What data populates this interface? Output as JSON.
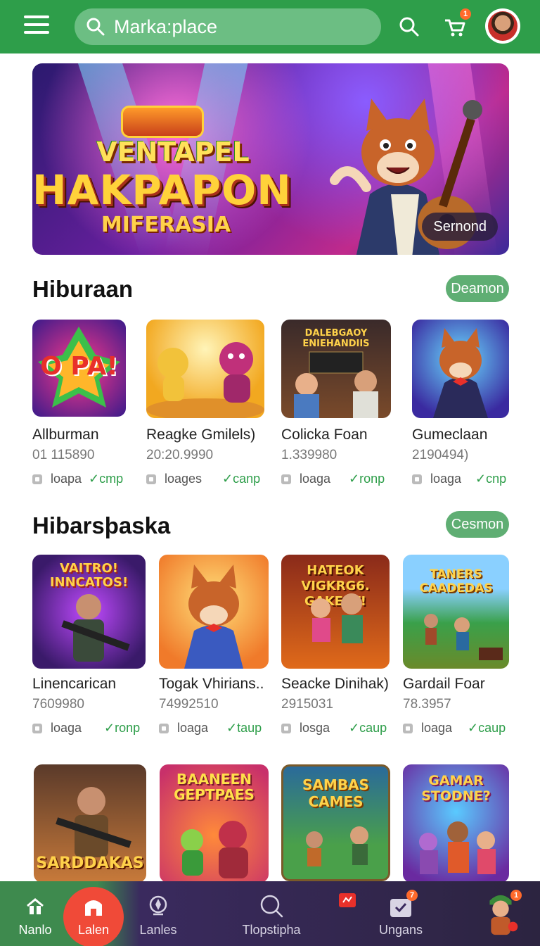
{
  "header": {
    "search_placeholder": "Marka:place",
    "notification_count": "1",
    "icons": [
      "menu-icon",
      "search-icon",
      "cart-icon",
      "avatar"
    ]
  },
  "banner": {
    "line1": "VENTAPEL",
    "line2": "HAKPAPON",
    "line3": "MIFERASIA",
    "button": "Sernond"
  },
  "section1": {
    "title": "Hiburaan",
    "button": "Deamon",
    "items": [
      {
        "title": "Allburman",
        "number": "01 115890",
        "tag": "loapa",
        "status": "✓cmp",
        "thumb_text": "O PA!"
      },
      {
        "title": "Reagke Gmilels)",
        "number": "20:20.9990",
        "tag": "loages",
        "status": "✓canp",
        "thumb_text": ""
      },
      {
        "title": "Colicka Foan",
        "number": "1.339980",
        "tag": "loaga",
        "status": "✓ronp",
        "thumb_text": "DALEBGAOY ENIEHANDIIS"
      },
      {
        "title": "Gumeclaan",
        "number": "2190494)",
        "tag": "loaga",
        "status": "✓cnp",
        "thumb_text": ""
      }
    ]
  },
  "section2": {
    "title": "Hibarsþaska",
    "button": "Cesmon",
    "items": [
      {
        "title": "Linencarican",
        "number": "7609980",
        "tag": "loaga",
        "status": "✓ronp",
        "thumb_text": "VAITRO! INNCATOS!"
      },
      {
        "title": "Togak Vhirians..",
        "number": "74992510",
        "tag": "loaga",
        "status": "✓taup",
        "thumb_text": ""
      },
      {
        "title": "Seacke Dinihak)",
        "number": "2915031",
        "tag": "losga",
        "status": "✓caup",
        "thumb_text": "HATEOK VIGKRG6. GAKEAT!"
      },
      {
        "title": "Gardail Foar",
        "number": "78.3957",
        "tag": "loaga",
        "status": "✓caup",
        "thumb_text": "TANERS CAADEDAS"
      }
    ]
  },
  "section3": {
    "items": [
      {
        "thumb_text": "SARDDAKAS"
      },
      {
        "thumb_text": "BAANEEN GEPTPAES"
      },
      {
        "thumb_text": "SAMBAS CAMES"
      },
      {
        "thumb_text": "GAMAR STODNE?"
      }
    ]
  },
  "bottom_nav": {
    "items": [
      {
        "label": "Nanlo",
        "icon": "home-icon"
      },
      {
        "label": "Lalen",
        "icon": "store-icon"
      },
      {
        "label": "Lanles",
        "icon": "compass-icon"
      },
      {
        "label": "Tlopstipha",
        "icon": "search-icon"
      },
      {
        "label": "",
        "icon": "gift-icon"
      },
      {
        "label": "Ungans",
        "icon": "inbox-icon"
      },
      {
        "label": "",
        "icon": "character-icon"
      }
    ],
    "inbox_badge": "7",
    "character_badge": "1",
    "active_index": 1
  },
  "colors": {
    "header_green": "#2e9e4a",
    "pill_green": "#5fae73",
    "accent_orange": "#f04a38",
    "nav_dark": "#2c2440"
  }
}
